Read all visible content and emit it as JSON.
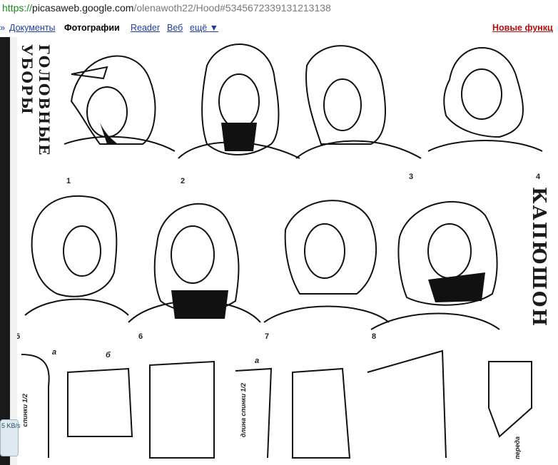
{
  "address_bar": {
    "protocol": "https://",
    "host": "picasaweb.google.com",
    "path": "/olenawoth22/Hood#5345672339131213138"
  },
  "google_bar": {
    "items": [
      {
        "label": "Документы"
      },
      {
        "label": "Фотографии"
      },
      {
        "label": "Reader"
      },
      {
        "label": "Веб"
      },
      {
        "label": "ещё ▼"
      }
    ],
    "prefix": "»",
    "right_link": "Новые функц"
  },
  "photo": {
    "left_vertical_caption": "ГОЛОВНЫЕ УБОРЫ",
    "right_vertical_caption": "КАПЮШОН",
    "figure_numbers": [
      "1",
      "2",
      "3",
      "4",
      "5",
      "6",
      "7",
      "8"
    ],
    "pattern_labels": {
      "a1": "а",
      "b1": "б",
      "a2": "а"
    },
    "pattern_texts": [
      "спинки 1/2",
      "длина спинки 1/2",
      "переда"
    ]
  },
  "status": {
    "speed": "5 KB/s"
  }
}
